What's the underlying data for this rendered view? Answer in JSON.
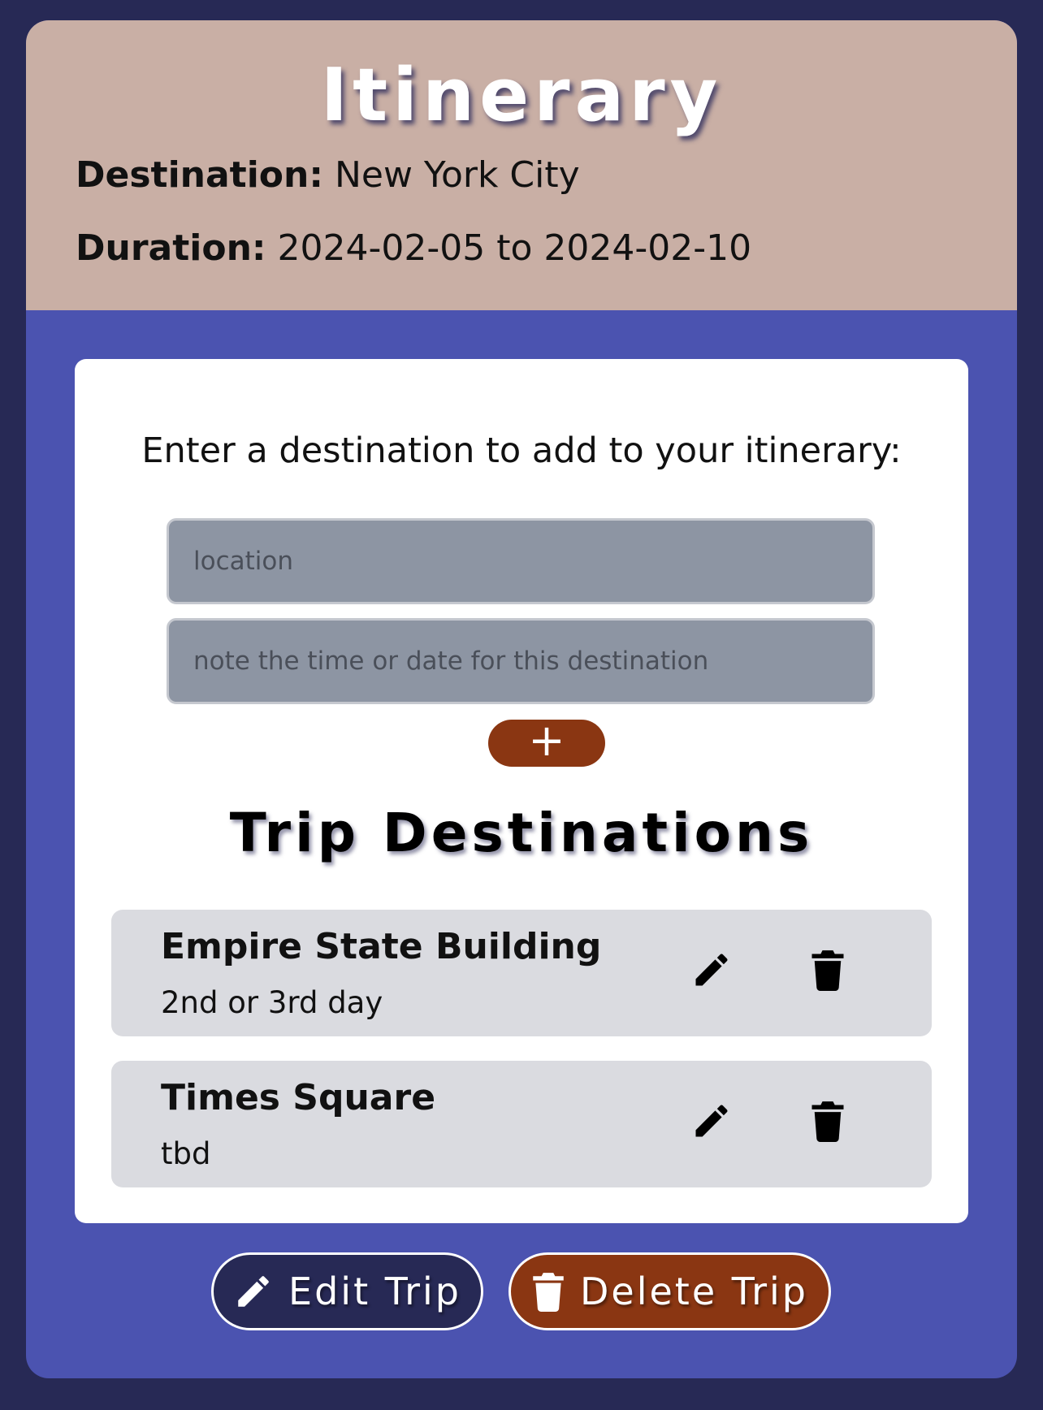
{
  "header": {
    "title": "Itinerary",
    "destination_label": "Destination:",
    "destination_value": "New York City",
    "duration_label": "Duration:",
    "duration_value": "2024-02-05 to 2024-02-10"
  },
  "form": {
    "prompt": "Enter a destination to add to your itinerary:",
    "location_placeholder": "location",
    "note_placeholder": "note the time or date for this destination",
    "add_label": "+"
  },
  "list": {
    "title": "Trip Destinations",
    "items": [
      {
        "name": "Empire State Building",
        "note": "2nd or 3rd day"
      },
      {
        "name": "Times Square",
        "note": "tbd"
      }
    ]
  },
  "actions": {
    "edit_trip": "Edit Trip",
    "delete_trip": "Delete Trip"
  },
  "icons": {
    "edit": "pencil-icon",
    "delete": "trash-icon"
  },
  "colors": {
    "background": "#272955",
    "card": "#4b53b0",
    "header": "#c9afa5",
    "accent": "#8a3612",
    "input": "#8d95a3",
    "list_item": "#dadbe0"
  }
}
